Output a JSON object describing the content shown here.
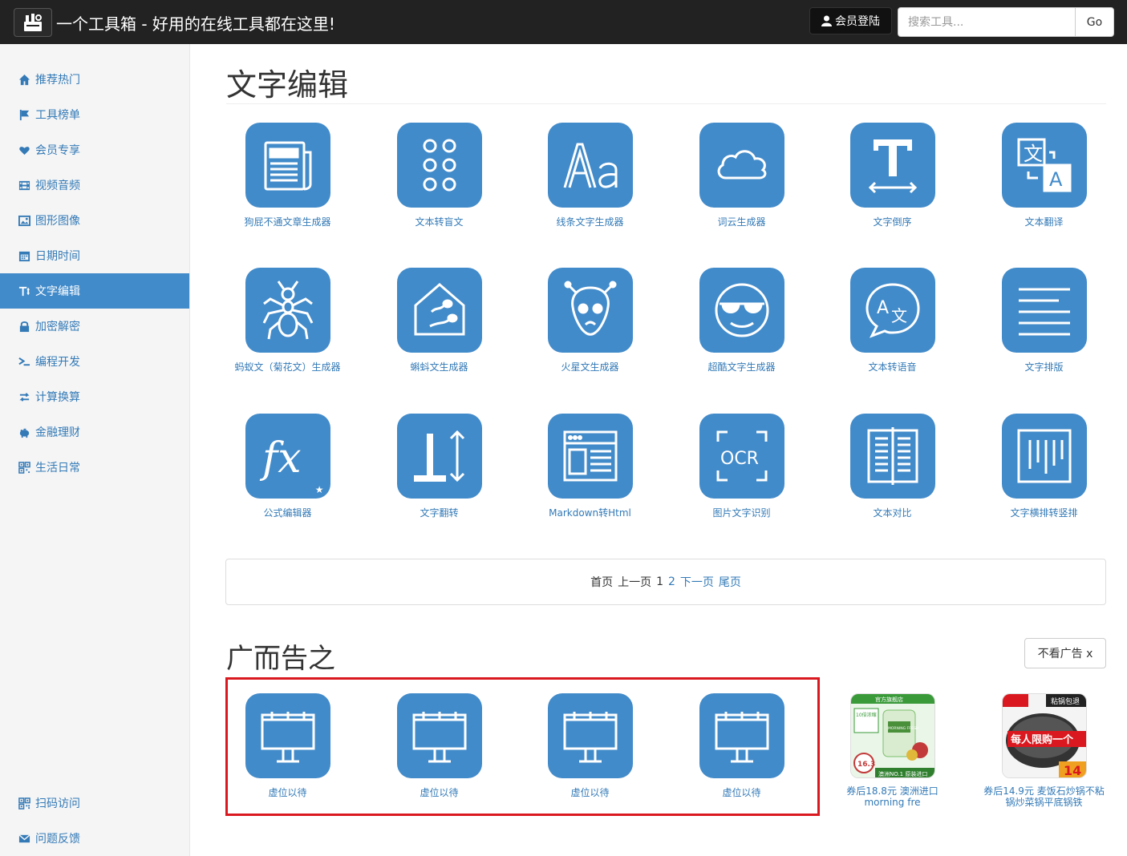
{
  "header": {
    "title": "一个工具箱 - 好用的在线工具都在这里!",
    "login_label": "会员登陆",
    "search_placeholder": "搜索工具...",
    "go_label": "Go"
  },
  "sidebar": {
    "items": [
      {
        "label": "推荐热门",
        "icon": "home-icon"
      },
      {
        "label": "工具榜单",
        "icon": "flag-icon"
      },
      {
        "label": "会员专享",
        "icon": "heart-icon"
      },
      {
        "label": "视频音频",
        "icon": "film-icon"
      },
      {
        "label": "图形图像",
        "icon": "picture-icon"
      },
      {
        "label": "日期时间",
        "icon": "calendar-icon"
      },
      {
        "label": "文字编辑",
        "icon": "text-height-icon",
        "active": true
      },
      {
        "label": "加密解密",
        "icon": "lock-icon"
      },
      {
        "label": "编程开发",
        "icon": "terminal-icon"
      },
      {
        "label": "计算换算",
        "icon": "transfer-icon"
      },
      {
        "label": "金融理财",
        "icon": "piggy-bank-icon"
      },
      {
        "label": "生活日常",
        "icon": "grid-icon"
      }
    ],
    "bottom_items": [
      {
        "label": "扫码访问",
        "icon": "qrcode-icon"
      },
      {
        "label": "问题反馈",
        "icon": "envelope-icon"
      }
    ]
  },
  "main": {
    "section_title": "文字编辑",
    "tools": [
      {
        "label": "狗屁不通文章生成器",
        "icon": "newspaper-icon"
      },
      {
        "label": "文本转盲文",
        "icon": "braille-icon"
      },
      {
        "label": "线条文字生成器",
        "icon": "font-aa-icon"
      },
      {
        "label": "词云生成器",
        "icon": "cloud-icon"
      },
      {
        "label": "文字倒序",
        "icon": "text-width-icon"
      },
      {
        "label": "文本翻译",
        "icon": "translate-icon"
      },
      {
        "label": "蚂蚁文（菊花文）生成器",
        "icon": "ant-icon"
      },
      {
        "label": "蝌蚪文生成器",
        "icon": "tadpole-house-icon"
      },
      {
        "label": "火星文生成器",
        "icon": "alien-icon"
      },
      {
        "label": "超酷文字生成器",
        "icon": "cool-face-icon"
      },
      {
        "label": "文本转语音",
        "icon": "speech-bubble-icon"
      },
      {
        "label": "文字排版",
        "icon": "align-lines-icon"
      },
      {
        "label": "公式编辑器",
        "icon": "function-icon",
        "member": true
      },
      {
        "label": "文字翻转",
        "icon": "text-flip-icon"
      },
      {
        "label": "Markdown转Html",
        "icon": "browser-window-icon"
      },
      {
        "label": "图片文字识别",
        "icon": "ocr-icon"
      },
      {
        "label": "文本对比",
        "icon": "compare-icon"
      },
      {
        "label": "文字横排转竖排",
        "icon": "vertical-text-icon"
      }
    ],
    "pager": {
      "first": "首页",
      "prev": "上一页",
      "current": "1",
      "page2": "2",
      "next": "下一页",
      "last": "尾页"
    }
  },
  "ads": {
    "section_title": "广而告之",
    "hide_label": "不看广告 x",
    "placeholders": [
      {
        "label": "虚位以待",
        "icon": "billboard-icon"
      },
      {
        "label": "虚位以待",
        "icon": "billboard-icon"
      },
      {
        "label": "虚位以待",
        "icon": "billboard-icon"
      },
      {
        "label": "虚位以待",
        "icon": "billboard-icon"
      }
    ],
    "products": [
      {
        "label": "券后18.8元 澳洲进口morning fre",
        "image_text": [
          "10倍浓缩",
          "MORNING FRESH",
          "澳洲NO.1 原装进口",
          "16.3"
        ]
      },
      {
        "label": "券后14.9元 麦饭石炒锅不粘锅炒菜锅平底锅铁",
        "image_text": [
          "粘锅包退",
          "每人限购一个",
          "14"
        ]
      }
    ]
  }
}
